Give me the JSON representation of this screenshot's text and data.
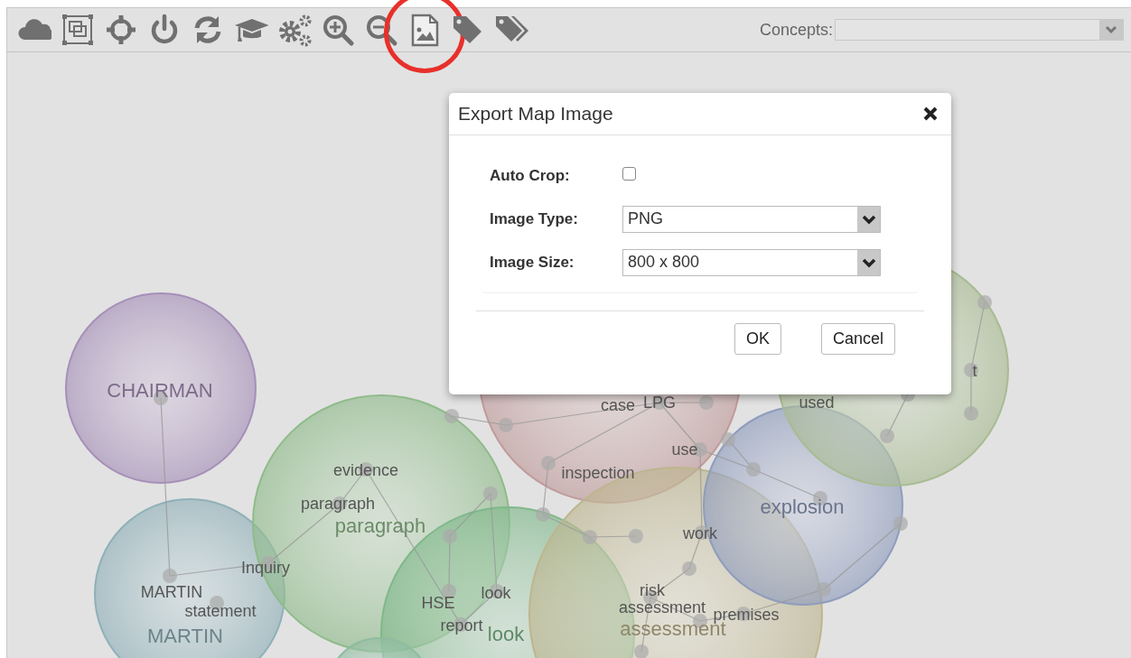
{
  "toolbar": {
    "tools": [
      {
        "kind": "cloud",
        "highlighted": false
      },
      {
        "kind": "frame",
        "highlighted": false
      },
      {
        "kind": "crosshair",
        "highlighted": false
      },
      {
        "kind": "power",
        "highlighted": false
      },
      {
        "kind": "refresh",
        "highlighted": false
      },
      {
        "kind": "cap",
        "highlighted": false
      },
      {
        "kind": "gears",
        "highlighted": false
      },
      {
        "kind": "zoomin",
        "highlighted": false
      },
      {
        "kind": "zoomout",
        "highlighted": false
      },
      {
        "kind": "image",
        "highlighted": true
      },
      {
        "kind": "tag",
        "highlighted": false
      },
      {
        "kind": "tags",
        "highlighted": false
      }
    ],
    "concepts": {
      "label": "Concepts:"
    }
  },
  "map": {
    "bubbles": [
      {
        "label": "CHAIRMAN",
        "color": "#a58fb8"
      },
      {
        "label": "MARTIN",
        "color": "#8fb0b8"
      },
      {
        "label": "paragraph",
        "color": "#8fbb8a"
      },
      {
        "label": "look",
        "color": "#7fb88a"
      },
      {
        "color": "#c09a9a"
      },
      {
        "label": "assessment",
        "color": "#bdb58e"
      },
      {
        "label": "explosion",
        "color": "#8e9cbc"
      },
      {
        "color": "#a8bb92"
      },
      {
        "color": "#8fbba0"
      }
    ],
    "terms": [
      "t",
      "case",
      "LPG",
      "used",
      "use",
      "evidence",
      "inspection",
      "paragraph",
      "work",
      "Inquiry",
      "MARTIN",
      "look",
      "risk",
      "HSE",
      "statement",
      "assessment",
      "premises",
      "report"
    ]
  },
  "dialog": {
    "title": "Export Map Image",
    "fields": [
      {
        "kind": "checkbox",
        "label": "Auto Crop:",
        "checked": false
      },
      {
        "kind": "select",
        "label": "Image Type:",
        "value": "PNG"
      },
      {
        "kind": "select",
        "label": "Image Size:",
        "value": "800 x 800"
      }
    ],
    "buttons": [
      "OK",
      "Cancel"
    ]
  }
}
